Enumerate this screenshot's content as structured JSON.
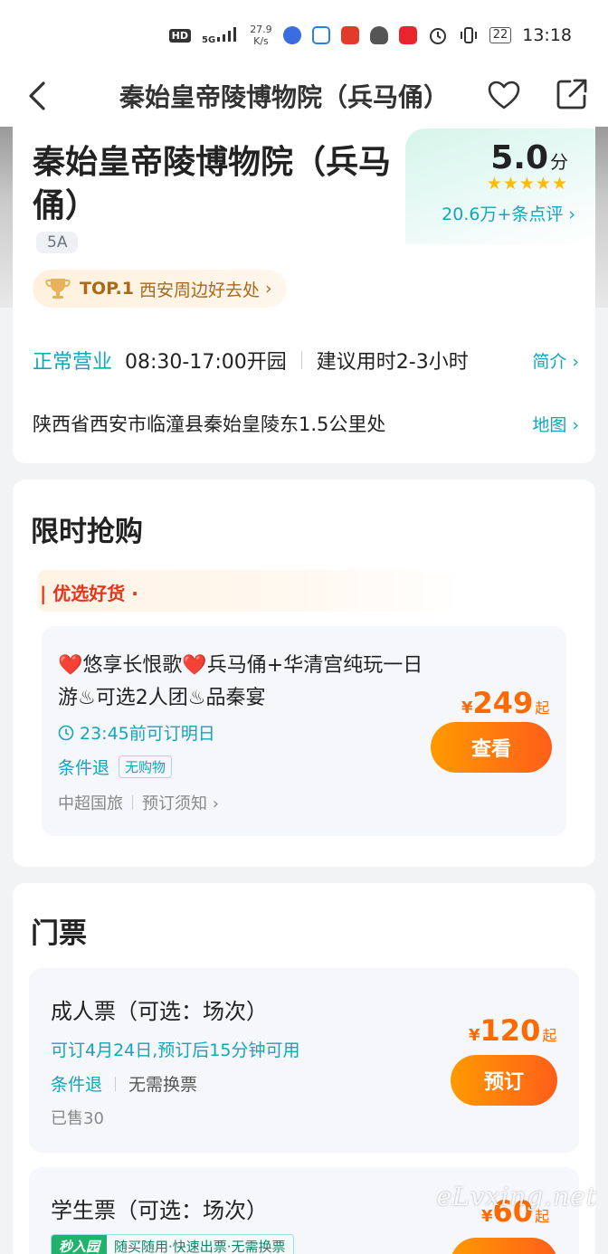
{
  "status_bar": {
    "hd": "HD",
    "network": "5G",
    "speed_value": "27.9",
    "speed_unit": "K/s",
    "battery": "22",
    "time": "13:18"
  },
  "nav": {
    "title": "秦始皇帝陵博物院（兵马俑）"
  },
  "poi": {
    "name": "秦始皇帝陵博物院（兵马俑）",
    "level": "5A",
    "rating": "5.0",
    "rating_unit": "分",
    "stars": 5,
    "review_count": "20.6万+条点评",
    "top_rank": "TOP.1",
    "top_label": "西安周边好去处",
    "open_status": "正常营业",
    "open_hours": "08:30-17:00开园",
    "suggest_time": "建议用时2-3小时",
    "intro_link": "简介",
    "address": "陕西省西安市临潼县秦始皇陵东1.5公里处",
    "map_link": "地图"
  },
  "flash_sale": {
    "title": "限时抢购",
    "banner": "| 优选好货 ·",
    "deal": {
      "title": "❤️悠享长恨歌❤️兵马俑+华清宫纯玩一日游♨可选2人团♨品秦宴",
      "deadline": "23:45前可订明日",
      "cancel_tag": "条件退",
      "shopping_tag": "无购物",
      "supplier": "中超国旅",
      "notice": "预订须知",
      "currency": "¥",
      "price": "249",
      "price_suffix": "起",
      "button": "查看"
    }
  },
  "tickets": {
    "title": "门票",
    "items": [
      {
        "name": "成人票（可选：场次）",
        "availability": "可订4月24日,预订后15分钟可用",
        "cancel_tag": "条件退",
        "exchange_tag": "无需换票",
        "sold": "已售30",
        "currency": "¥",
        "price": "120",
        "price_suffix": "起",
        "button": "预订"
      },
      {
        "name": "学生票（可选：场次）",
        "seckill_badge": "秒入园",
        "seckill_text": "随买随用·快速出票·无需换票",
        "currency": "¥",
        "price": "60",
        "price_suffix": "起"
      }
    ]
  },
  "watermark": "eLvxing.net",
  "colors": {
    "teal": "#12a6b8",
    "orange": "#ff6a00",
    "red": "#e2361c",
    "star": "#ffbb00"
  }
}
